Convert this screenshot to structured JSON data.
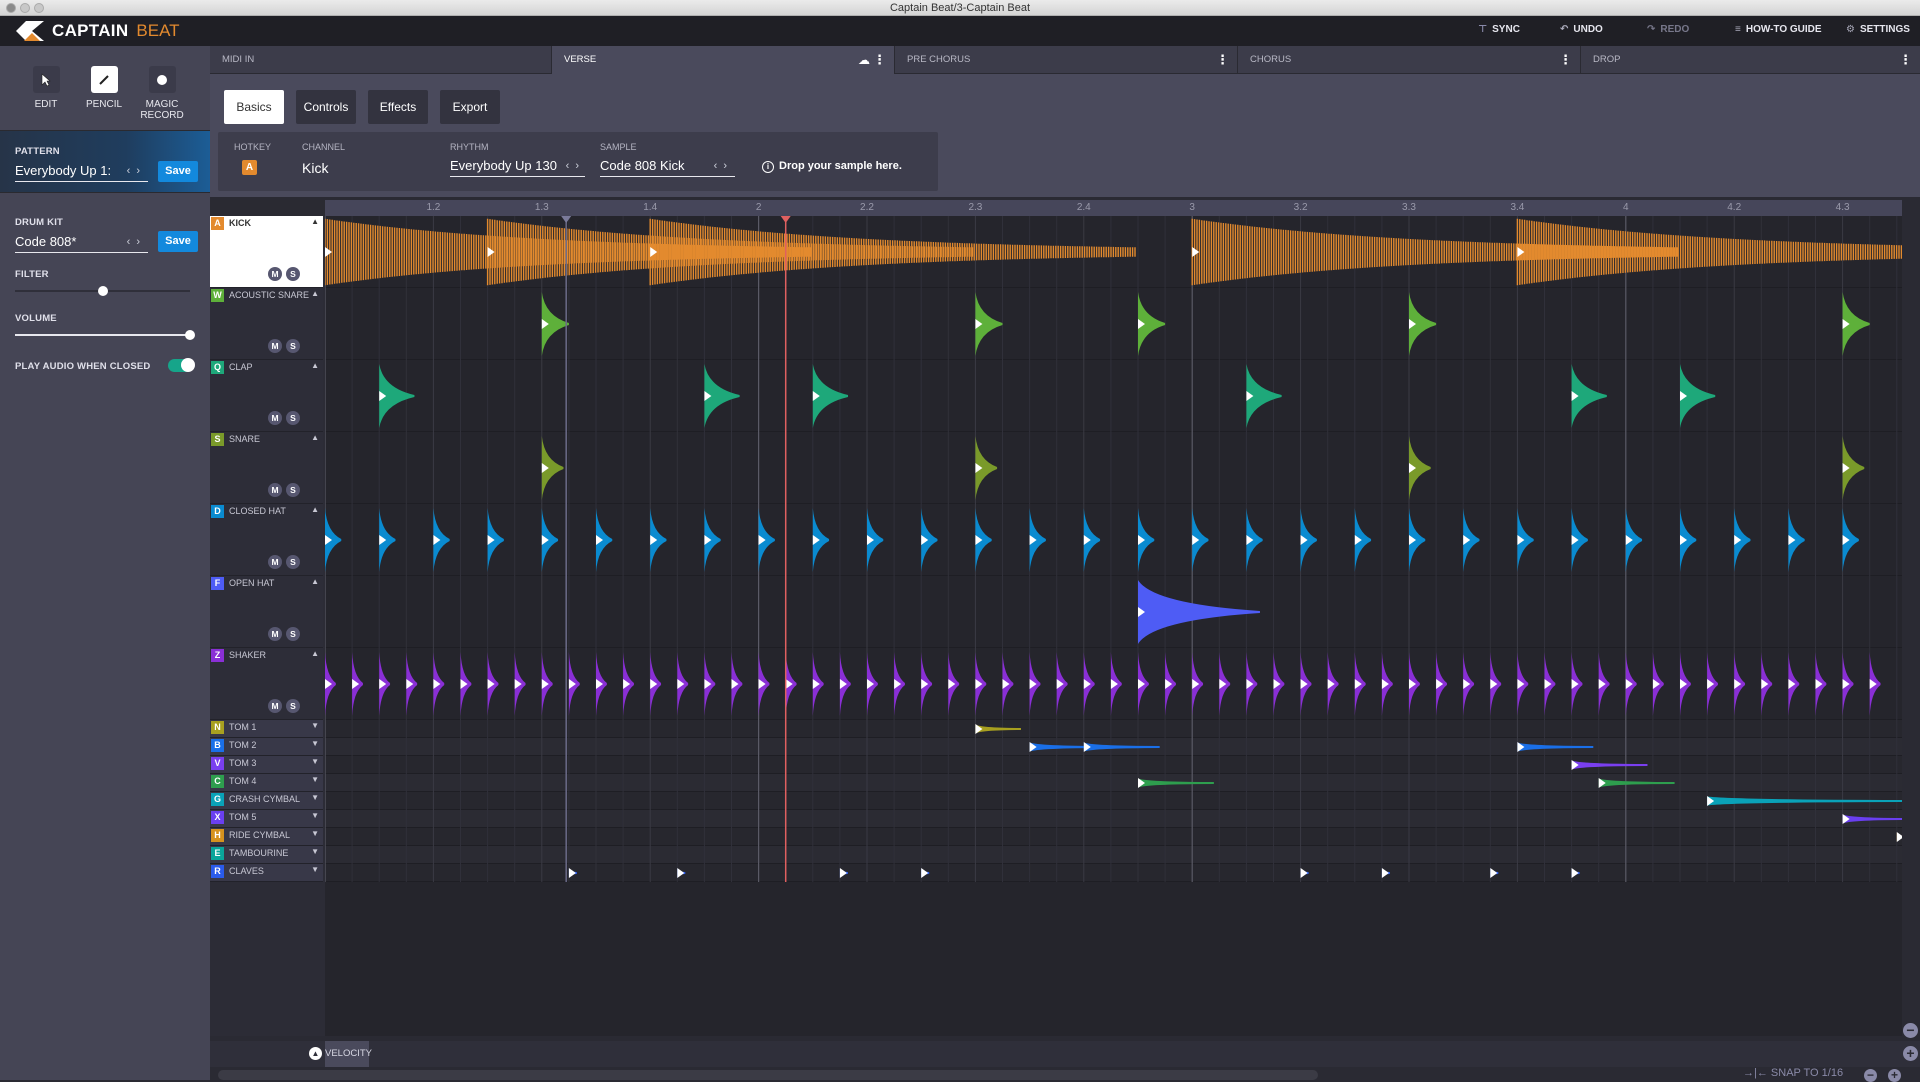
{
  "window": {
    "title": "Captain Beat/3-Captain Beat"
  },
  "app": {
    "name_bold": "CAPTAIN",
    "name_light": "BEAT",
    "brand_color": "#e38a2e"
  },
  "toolbar": {
    "sync": "SYNC",
    "undo": "UNDO",
    "redo": "REDO",
    "guide": "HOW-TO GUIDE",
    "settings": "SETTINGS"
  },
  "tools": [
    {
      "label": "EDIT",
      "icon": "cursor-icon",
      "active": false
    },
    {
      "label": "PENCIL",
      "icon": "pencil-icon",
      "active": true
    },
    {
      "label": "MAGIC RECORD",
      "icon": "record-dot-icon",
      "active": false
    }
  ],
  "sidebar": {
    "pattern_label": "PATTERN",
    "pattern_value": "Everybody Up 1:",
    "drumkit_label": "DRUM KIT",
    "drumkit_value": "Code 808*",
    "save_label": "Save",
    "filter_label": "FILTER",
    "filter_value": 0.5,
    "volume_label": "VOLUME",
    "volume_value": 1.0,
    "play_audio_label": "PLAY AUDIO WHEN CLOSED",
    "play_audio_on": true
  },
  "sections": [
    {
      "label": "MIDI IN",
      "active": false,
      "menu": false
    },
    {
      "label": "VERSE",
      "active": true,
      "menu": true,
      "cloud": true
    },
    {
      "label": "PRE CHORUS",
      "active": false,
      "menu": true
    },
    {
      "label": "CHORUS",
      "active": false,
      "menu": true
    },
    {
      "label": "DROP",
      "active": false,
      "menu": true
    }
  ],
  "panel_tabs": [
    {
      "label": "Basics",
      "active": true
    },
    {
      "label": "Controls",
      "active": false
    },
    {
      "label": "Effects",
      "active": false
    },
    {
      "label": "Export",
      "active": false
    }
  ],
  "basics": {
    "hotkey_label": "HOTKEY",
    "hotkey": "A",
    "channel_label": "CHANNEL",
    "channel": "Kick",
    "rhythm_label": "RHYTHM",
    "rhythm": "Everybody Up 130",
    "sample_label": "SAMPLE",
    "sample": "Code 808 Kick",
    "drop_hint": "Drop your sample here."
  },
  "ruler": {
    "ticks": [
      "1.2",
      "1.3",
      "1.4",
      "2",
      "2.2",
      "2.3",
      "2.4",
      "3",
      "3.2",
      "3.3",
      "3.4",
      "4",
      "4.2",
      "4.3"
    ],
    "steps_per_bar": 16,
    "loop_marker_step": 8.9,
    "playhead_step": 17
  },
  "tracks": [
    {
      "key": "A",
      "name": "KICK",
      "color": "#e38a2e",
      "expanded": true,
      "selected": true,
      "steps": [
        0,
        6,
        12,
        32,
        44
      ],
      "decay": 18
    },
    {
      "key": "W",
      "name": "ACOUSTIC SNARE",
      "color": "#5eb03a",
      "expanded": true,
      "steps": [
        8,
        24,
        30,
        40,
        56
      ],
      "decay": 1
    },
    {
      "key": "Q",
      "name": "CLAP",
      "color": "#1ea87a",
      "expanded": true,
      "steps": [
        2,
        14,
        18,
        34,
        46,
        50
      ],
      "decay": 1.3
    },
    {
      "key": "S",
      "name": "SNARE",
      "color": "#7a9a2a",
      "expanded": true,
      "steps": [
        8,
        24,
        40,
        56
      ],
      "decay": 0.8
    },
    {
      "key": "D",
      "name": "CLOSED HAT",
      "color": "#0a8bd0",
      "expanded": true,
      "steps": [
        0,
        2,
        4,
        6,
        8,
        10,
        12,
        14,
        16,
        18,
        20,
        22,
        24,
        26,
        28,
        30,
        32,
        34,
        36,
        38,
        40,
        42,
        44,
        46,
        48,
        50,
        52,
        54,
        56
      ],
      "decay": 0.6
    },
    {
      "key": "F",
      "name": "OPEN HAT",
      "color": "#4e5cf5",
      "expanded": true,
      "steps": [
        30
      ],
      "decay": 4.5
    },
    {
      "key": "Z",
      "name": "SHAKER",
      "color": "#8a2fd6",
      "expanded": true,
      "steps": [
        0,
        1,
        2,
        3,
        4,
        5,
        6,
        7,
        8,
        9,
        10,
        11,
        12,
        13,
        14,
        15,
        16,
        17,
        18,
        19,
        20,
        21,
        22,
        23,
        24,
        25,
        26,
        27,
        28,
        29,
        30,
        31,
        32,
        33,
        34,
        35,
        36,
        37,
        38,
        39,
        40,
        41,
        42,
        43,
        44,
        45,
        46,
        47,
        48,
        49,
        50,
        51,
        52,
        53,
        54,
        55,
        56,
        57
      ],
      "decay": 0.4
    },
    {
      "key": "N",
      "name": "TOM 1",
      "color": "#a8a020",
      "expanded": false,
      "steps": [
        24
      ],
      "decay": 1.2
    },
    {
      "key": "B",
      "name": "TOM 2",
      "color": "#1a6fe8",
      "expanded": false,
      "steps": [
        26,
        28,
        44
      ],
      "decay": 2
    },
    {
      "key": "V",
      "name": "TOM 3",
      "color": "#7a3ff0",
      "expanded": false,
      "steps": [
        46
      ],
      "decay": 2
    },
    {
      "key": "C",
      "name": "TOM 4",
      "color": "#2e9e4e",
      "expanded": false,
      "steps": [
        30,
        47
      ],
      "decay": 2
    },
    {
      "key": "G",
      "name": "CRASH CYMBAL",
      "color": "#0aa2b8",
      "expanded": false,
      "steps": [
        51
      ],
      "decay": 6
    },
    {
      "key": "X",
      "name": "TOM 5",
      "color": "#6a3ff0",
      "expanded": false,
      "steps": [
        56
      ],
      "decay": 1.6
    },
    {
      "key": "H",
      "name": "RIDE CYMBAL",
      "color": "#d6921e",
      "expanded": false,
      "steps": [
        58
      ],
      "decay": 0.2
    },
    {
      "key": "E",
      "name": "TAMBOURINE",
      "color": "#0aa59a",
      "expanded": false,
      "steps": [],
      "decay": 1
    },
    {
      "key": "R",
      "name": "CLAVES",
      "color": "#2a5bea",
      "expanded": false,
      "steps": [
        9,
        13,
        19,
        22,
        36,
        39,
        43,
        46
      ],
      "decay": 0.2
    }
  ],
  "mute_label": "M",
  "solo_label": "S",
  "bottom": {
    "velocity_label": "VELOCITY",
    "snap_label": "SNAP TO 1/16"
  }
}
